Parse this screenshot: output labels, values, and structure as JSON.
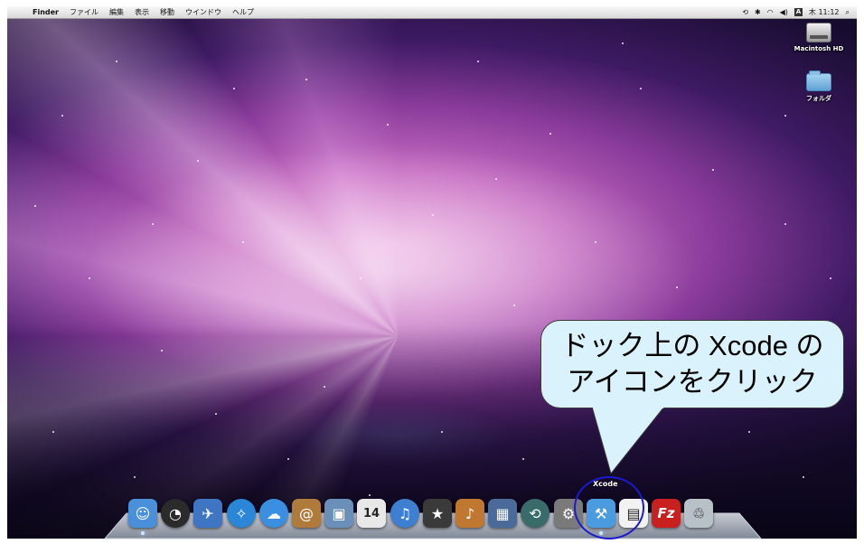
{
  "menubar": {
    "apple_glyph": "",
    "app_name": "Finder",
    "menus": [
      "ファイル",
      "編集",
      "表示",
      "移動",
      "ウインドウ",
      "ヘルプ"
    ],
    "status": {
      "time_machine_icon": "time-machine-icon",
      "bluetooth_icon": "bluetooth-icon",
      "wifi_icon": "wifi-icon",
      "volume_icon": "volume-icon",
      "input_method": "A",
      "clock": "木 11:12",
      "spotlight_icon": "spotlight-icon"
    }
  },
  "desktop": {
    "icons": [
      {
        "label": "Macintosh HD",
        "icon": "hard-drive-icon"
      },
      {
        "label": "フォルダ",
        "icon": "folder-icon"
      }
    ]
  },
  "callout": {
    "line1": "ドック上の Xcode の",
    "line2": "アイコンをクリック"
  },
  "dock": {
    "hover_label": "Xcode",
    "items": [
      {
        "name": "finder",
        "icon": "finder-icon",
        "color": "#4a8fd9"
      },
      {
        "name": "dashboard",
        "icon": "dashboard-icon",
        "color": "#2b2b2b"
      },
      {
        "name": "mail",
        "icon": "mail-icon",
        "color": "#3f76c4"
      },
      {
        "name": "safari",
        "icon": "safari-icon",
        "color": "#2a86d6"
      },
      {
        "name": "ichat",
        "icon": "ichat-icon",
        "color": "#3b8fe0"
      },
      {
        "name": "address-book",
        "icon": "address-book-icon",
        "color": "#b07a3a"
      },
      {
        "name": "iphoto",
        "icon": "iphoto-icon",
        "color": "#6a8fb8"
      },
      {
        "name": "ical",
        "icon": "calendar-icon",
        "color": "#e8e8e8",
        "text": "14"
      },
      {
        "name": "itunes",
        "icon": "itunes-icon",
        "color": "#3d7fd0"
      },
      {
        "name": "imovie",
        "icon": "imovie-icon",
        "color": "#3a3a3a"
      },
      {
        "name": "garageband",
        "icon": "garageband-icon",
        "color": "#c0772f"
      },
      {
        "name": "spaces",
        "icon": "spaces-icon",
        "color": "#4a6a9a"
      },
      {
        "name": "time-machine",
        "icon": "time-machine-icon",
        "color": "#3a6b6b"
      },
      {
        "name": "system-preferences",
        "icon": "system-preferences-icon",
        "color": "#7a7a7a"
      },
      {
        "name": "xcode",
        "icon": "xcode-icon",
        "color": "#4b9be0"
      },
      {
        "name": "document",
        "icon": "document-icon",
        "color": "#f2f2f2"
      },
      {
        "name": "filezilla",
        "icon": "filezilla-icon",
        "color": "#c81f1f",
        "text": "Fz"
      },
      {
        "name": "trash",
        "icon": "trash-icon",
        "color": "#b8c0c8"
      }
    ]
  }
}
